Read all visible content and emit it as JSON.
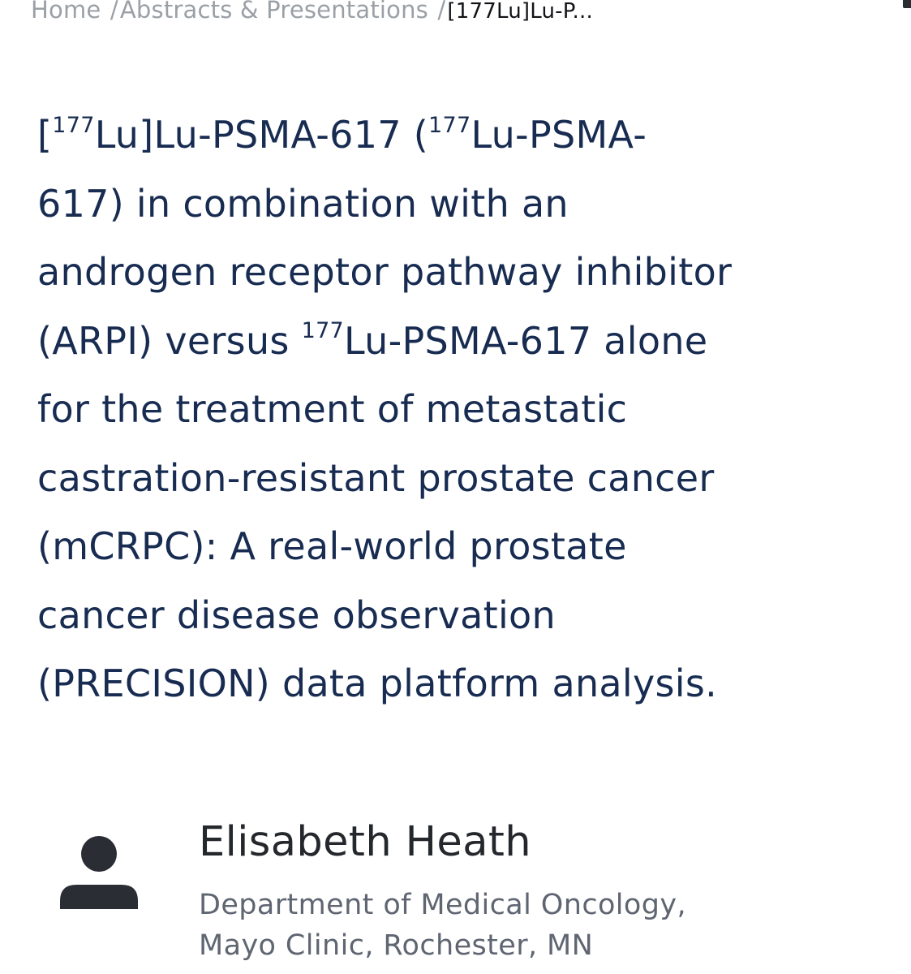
{
  "breadcrumb": {
    "home": "Home",
    "separator": "/",
    "section": "Abstracts & Presentations",
    "current": "[177Lu]Lu-P..."
  },
  "title": {
    "lines": [
      {
        "parts": [
          {
            "t": "["
          },
          {
            "sup": "177"
          },
          {
            "t": "Lu]Lu-PSMA-617 ("
          },
          {
            "sup": "177"
          },
          {
            "t": "Lu-PSMA-"
          }
        ]
      },
      {
        "parts": [
          {
            "t": "617) in combination with an"
          }
        ]
      },
      {
        "parts": [
          {
            "t": "androgen receptor pathway inhibitor"
          }
        ]
      },
      {
        "parts": [
          {
            "t": "(ARPI) versus "
          },
          {
            "sup": "177"
          },
          {
            "t": "Lu-PSMA-617 alone"
          }
        ]
      },
      {
        "parts": [
          {
            "t": "for the treatment of metastatic"
          }
        ]
      },
      {
        "parts": [
          {
            "t": "castration-resistant prostate cancer"
          }
        ]
      },
      {
        "parts": [
          {
            "t": "(mCRPC): A real-world prostate"
          }
        ]
      },
      {
        "parts": [
          {
            "t": "cancer disease observation"
          }
        ]
      },
      {
        "parts": [
          {
            "t": "(PRECISION) data platform analysis."
          }
        ]
      }
    ]
  },
  "author": {
    "icon": "person-icon",
    "name": "Elisabeth Heath",
    "affiliation_lines": [
      "Department of Medical Oncology,",
      "Mayo Clinic, Rochester, MN"
    ]
  },
  "colors": {
    "title": "#182c52",
    "breadcrumb": "#9aa0a6",
    "author_name": "#24272c",
    "affiliation": "#5f6672"
  }
}
